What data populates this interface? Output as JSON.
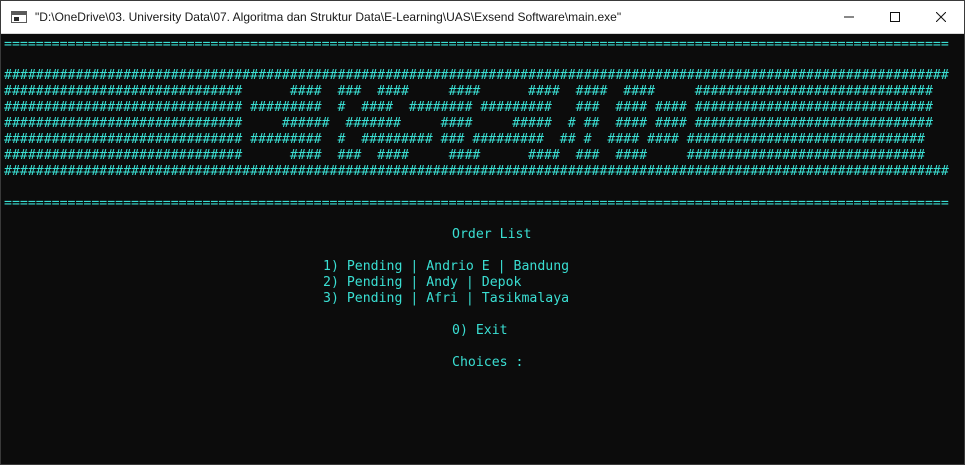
{
  "window": {
    "title": "\"D:\\OneDrive\\03. University Data\\07. Algoritma dan Struktur Data\\E-Learning\\UAS\\Exsend Software\\main.exe\""
  },
  "console": {
    "separator_top": "=======================================================================================================================",
    "banner": [
      "#######################################################################################################################",
      "##############################      ####  ###  ####     ####      ####  ####  ####     ##############################",
      "############################## #########  #  ####  ######## #########   ###  #### #### ##############################",
      "##############################     ######  #######     ####     #####  # ##  #### #### ##############################",
      "############################## #########  #  ######### ### #########  ## #  #### #### ##############################",
      "##############################      ####  ###  ####     ####      ####  ###  ####     ##############################",
      "#######################################################################################################################"
    ],
    "separator_bottom": "=======================================================================================================================",
    "heading": "Order List",
    "orders": [
      "1) Pending | Andrio E | Bandung",
      "2) Pending | Andy | Depok",
      "3) Pending | Afri | Tasikmalaya"
    ],
    "exit_option": "0) Exit",
    "prompt": "Choices :"
  },
  "colors": {
    "console_text": "#3adfd3",
    "console_bg": "#0c0c0c",
    "titlebar_bg": "#ffffff"
  },
  "icons": {
    "app": "console-app-icon",
    "minimize": "minimize-icon",
    "maximize": "maximize-icon",
    "close": "close-icon"
  }
}
